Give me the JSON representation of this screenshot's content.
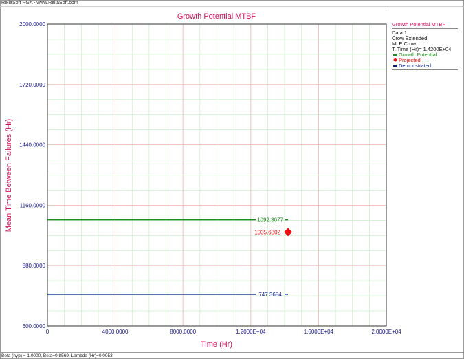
{
  "app": {
    "header": "ReliaSoft RGA - www.ReliaSoft.com",
    "footer": "Beta (hyp) = 1.0000, Beta=0.8569, Lambda (Hr)=0.0053"
  },
  "legend": {
    "title": "Growth Potential MTBF",
    "info": [
      "Data 1",
      "Crow Extended",
      "MLE Crow",
      "T. Time (Hr)= 1.4200E+04"
    ]
  },
  "chart_data": {
    "type": "line",
    "title": "Growth Potential MTBF",
    "xlabel": "Time (Hr)",
    "ylabel": "Mean Time Between Failures (Hr)",
    "xlim": [
      0,
      20000
    ],
    "ylim": [
      600,
      2000
    ],
    "x_ticks": [
      0,
      4000,
      8000,
      12000,
      16000,
      20000
    ],
    "x_tick_labels": [
      "0",
      "4000.0000",
      "8000.0000",
      "1.2000E+04",
      "1.6000E+04",
      "2.0000E+04"
    ],
    "y_ticks": [
      600,
      880,
      1160,
      1440,
      1720,
      2000
    ],
    "y_tick_labels": [
      "600.0000",
      "880.0000",
      "1160.0000",
      "1440.0000",
      "1720.0000",
      "2000.0000"
    ],
    "grid": true,
    "legend_position": "right",
    "series": [
      {
        "name": "Growth Potential",
        "kind": "line",
        "color": "#1a8f1a",
        "x": [
          0,
          14200
        ],
        "y": [
          1092.3077,
          1092.3077
        ],
        "label": "1092.3077"
      },
      {
        "name": "Projected",
        "kind": "point",
        "color": "#ee1111",
        "x": [
          14200
        ],
        "y": [
          1035.6802
        ],
        "label": "1035.6802"
      },
      {
        "name": "Demonstrated",
        "kind": "line",
        "color": "#0a1a8c",
        "x": [
          0,
          14200
        ],
        "y": [
          747.3684,
          747.3684
        ],
        "label": "747.3684"
      }
    ]
  },
  "colors": {
    "title": "#d4145a",
    "axis_text": "#1a1a8c",
    "major_grid": "#f4b8b8",
    "minor_grid": "#c6efc6"
  }
}
